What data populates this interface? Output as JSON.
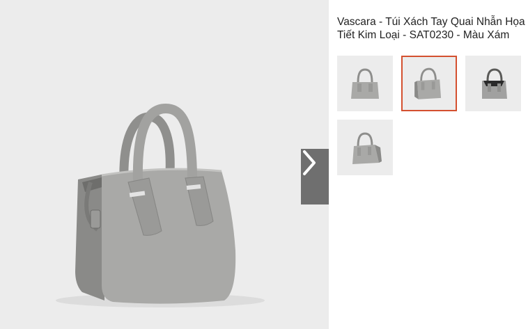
{
  "product": {
    "title": "Vascara - Túi Xách Tay Quai Nhẫn Họa Tiết Kim Loại - SAT0230 - Màu Xám"
  },
  "gallery": {
    "selected_index": 1,
    "thumbnails": [
      {
        "name": "bag-front-view"
      },
      {
        "name": "bag-angled-view"
      },
      {
        "name": "bag-open-top-view"
      },
      {
        "name": "bag-side-view"
      }
    ],
    "next_icon": "chevron-right-icon"
  },
  "colors": {
    "image_background": "#ececec",
    "bag_gray": "#a7a7a5",
    "selected_border": "#d4502f",
    "nav_button": "#6f6f6f"
  }
}
